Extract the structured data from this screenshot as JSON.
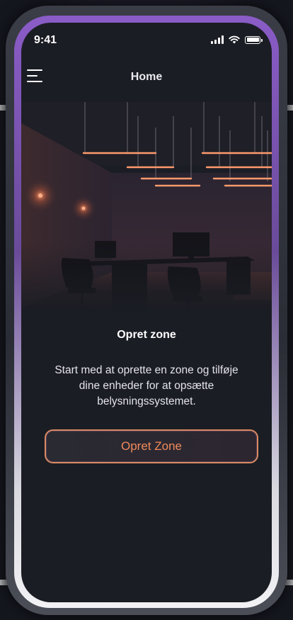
{
  "status_bar": {
    "time": "9:41",
    "signal_icon": "cellular-signal-icon",
    "wifi_icon": "wifi-icon",
    "battery_icon": "battery-icon"
  },
  "header": {
    "menu_icon": "hamburger-menu-icon",
    "title": "Home"
  },
  "hero": {
    "image": "dark-office-with-pendant-lights-illustration"
  },
  "empty_state": {
    "title": "Opret zone",
    "description": "Start med at oprette en zone og tilføje dine enheder for at opsætte belysningssystemet.",
    "button_label": "Opret Zone"
  },
  "colors": {
    "background": "#1b1d24",
    "accent": "#f08a5a",
    "button_border": "#d88a62",
    "rim_top": "#8a5cc7",
    "rim_bottom": "#f2f2f5"
  }
}
